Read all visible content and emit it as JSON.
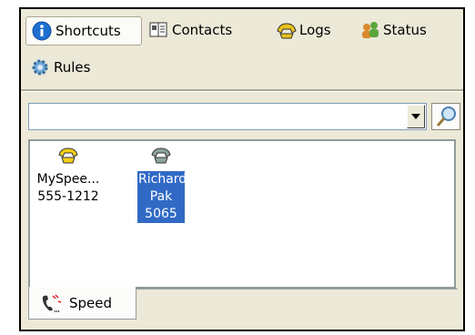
{
  "tabs": [
    {
      "label": "Shortcuts",
      "icon": "info-icon",
      "active": true
    },
    {
      "label": "Contacts",
      "icon": "address-book-icon",
      "active": false
    },
    {
      "label": "Logs",
      "icon": "phone-log-icon",
      "active": false
    },
    {
      "label": "Status",
      "icon": "users-status-icon",
      "active": false
    },
    {
      "label": "Rules",
      "icon": "gear-icon",
      "active": false
    }
  ],
  "search": {
    "value": "",
    "placeholder": ""
  },
  "speed_dials": [
    {
      "name": "MySpee...",
      "number": "555-1212",
      "selected": false,
      "icon": "phone-yellow-icon"
    },
    {
      "line1": "Richard",
      "line2": "Pak",
      "number": "5065",
      "selected": true,
      "icon": "phone-gray-icon"
    }
  ],
  "bottom_tab": {
    "label": "Speed",
    "icon": "speed-dial-icon"
  },
  "colors": {
    "selection": "#316ac5",
    "panel": "#ece9d8"
  }
}
